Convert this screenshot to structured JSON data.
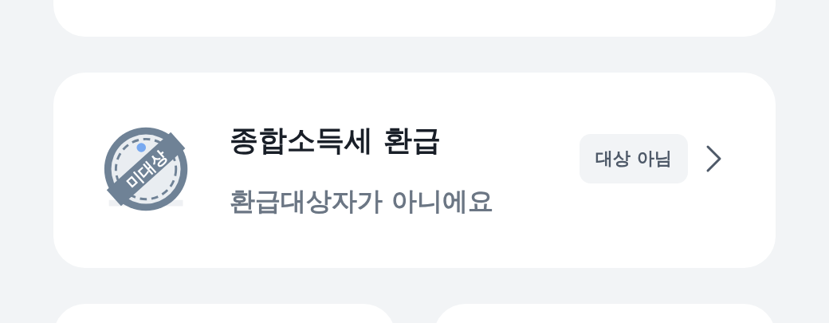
{
  "card": {
    "stamp": "미대상",
    "title": "종합소득세 환급",
    "subtitle": "환급대상자가 아니에요",
    "badge": "대상 아님"
  }
}
